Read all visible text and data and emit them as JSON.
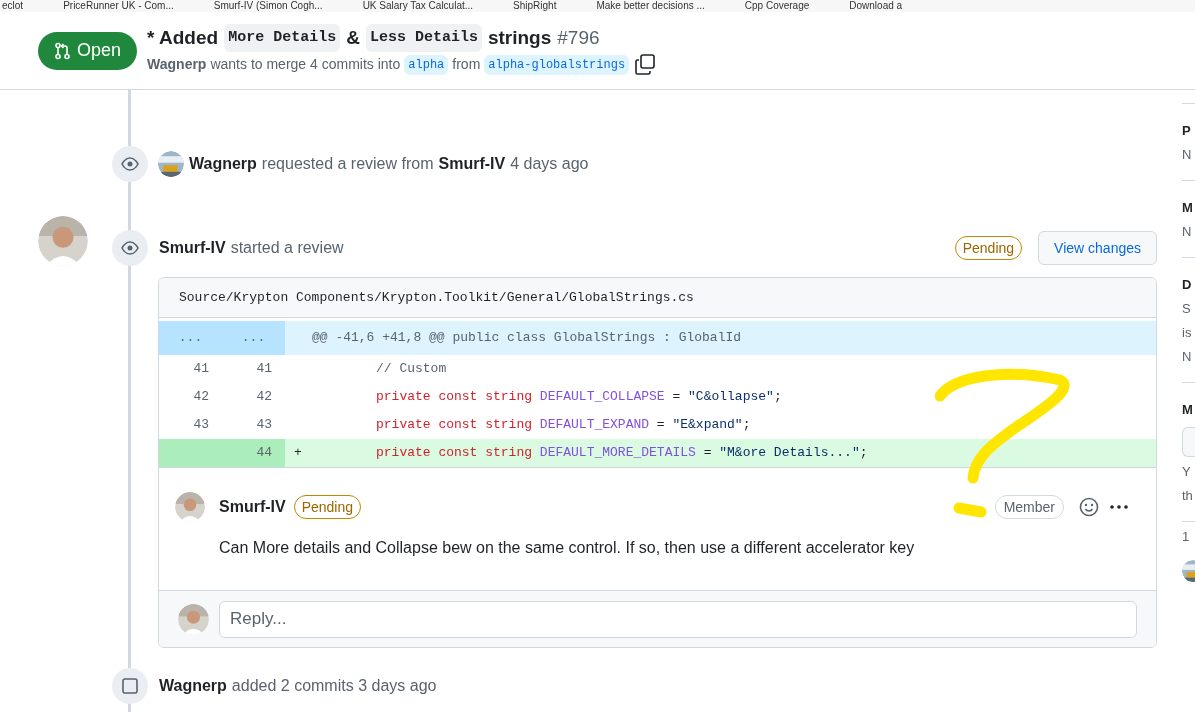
{
  "bookmarks": [
    {
      "text": "eclot"
    },
    {
      "text": "PriceRunner UK - Com..."
    },
    {
      "text": "Smurf-IV (Simon Cogh..."
    },
    {
      "text": "UK Salary Tax Calculat..."
    },
    {
      "text": "ShipRight"
    },
    {
      "text": "Make better decisions ..."
    },
    {
      "text": "Cpp Coverage"
    },
    {
      "text": "Download a"
    }
  ],
  "pr": {
    "status": "Open",
    "title_parts": [
      {
        "kind": "text",
        "text": "* Added"
      },
      {
        "kind": "code",
        "text": "More Details"
      },
      {
        "kind": "text",
        "text": "&"
      },
      {
        "kind": "code",
        "text": "Less Details"
      },
      {
        "kind": "text",
        "text": "strings"
      }
    ],
    "number": "#796",
    "author": "Wagnerp",
    "merge_text": "wants to merge 4 commits into",
    "base": "alpha",
    "from_text": "from",
    "head": "alpha-globalstrings"
  },
  "timeline": [
    {
      "kind": "review_requested",
      "actor": "Wagnerp",
      "text": "requested a review from",
      "target": "Smurf-IV",
      "time": "4 days ago"
    },
    {
      "kind": "review",
      "actor": "Smurf-IV",
      "text": "started a review",
      "badge": "Pending",
      "button": "View changes",
      "file": "Source/Krypton Components/Krypton.Toolkit/General/GlobalStrings.cs",
      "hunk": {
        "old": "...",
        "new": "...",
        "header": "@@ -41,6 +41,8 @@ public class GlobalStrings : GlobalId"
      },
      "lines": [
        {
          "kind": "context",
          "old": "41",
          "new": "41",
          "tokens": [
            {
              "kind": "comment",
              "text": "// Custom"
            }
          ]
        },
        {
          "kind": "context",
          "old": "42",
          "new": "42",
          "tokens": [
            {
              "kind": "keyword",
              "text": "private const string "
            },
            {
              "kind": "ident",
              "text": "DEFAULT_COLLAPSE"
            },
            {
              "kind": "plain",
              "text": " = "
            },
            {
              "kind": "string",
              "text": "\"C&ollapse\""
            },
            {
              "kind": "plain",
              "text": ";"
            }
          ]
        },
        {
          "kind": "context",
          "old": "43",
          "new": "43",
          "tokens": [
            {
              "kind": "keyword",
              "text": "private const string "
            },
            {
              "kind": "ident",
              "text": "DEFAULT_EXPAND"
            },
            {
              "kind": "plain",
              "text": " = "
            },
            {
              "kind": "string",
              "text": "\"E&xpand\""
            },
            {
              "kind": "plain",
              "text": ";"
            }
          ]
        },
        {
          "kind": "added",
          "sign": "+",
          "new": "44",
          "tokens": [
            {
              "kind": "keyword",
              "text": "private const string "
            },
            {
              "kind": "ident",
              "text": "DEFAULT_MORE_DETAILS"
            },
            {
              "kind": "plain",
              "text": " = "
            },
            {
              "kind": "string",
              "text": "\"M&ore Details...\""
            },
            {
              "kind": "plain",
              "text": ";"
            }
          ]
        }
      ],
      "comment": {
        "author": "Smurf-IV",
        "badge": "Pending",
        "role": "Member",
        "body": "Can More details and Collapse bew on the same control. If so, then use a different accelerator key"
      },
      "reply_placeholder": "Reply..."
    },
    {
      "kind": "commits",
      "actor": "Wagnerp",
      "text": "added 2 commits 3 days ago"
    }
  ],
  "sidebar": [
    {
      "kind": "heading",
      "text": "P"
    },
    {
      "kind": "text",
      "text": "N"
    },
    {
      "kind": "divider"
    },
    {
      "kind": "heading",
      "text": "M"
    },
    {
      "kind": "text",
      "text": "N"
    },
    {
      "kind": "divider"
    },
    {
      "kind": "heading",
      "text": "D"
    },
    {
      "kind": "text",
      "text": "S"
    },
    {
      "kind": "text",
      "text": "is"
    },
    {
      "kind": "text",
      "text": "N"
    },
    {
      "kind": "divider"
    },
    {
      "kind": "heading",
      "text": "M"
    },
    {
      "kind": "box"
    },
    {
      "kind": "text",
      "text": "Y"
    },
    {
      "kind": "text",
      "text": "th"
    },
    {
      "kind": "divider"
    },
    {
      "kind": "text",
      "text": "1"
    },
    {
      "kind": "avatar"
    }
  ]
}
